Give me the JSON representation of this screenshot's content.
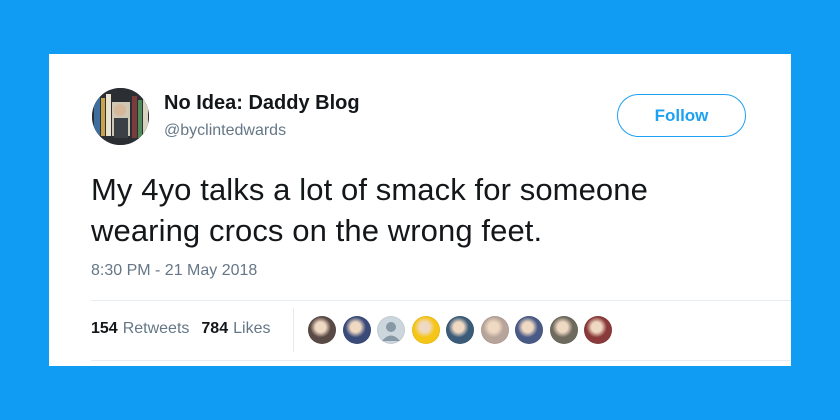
{
  "tweet": {
    "author_name": "No Idea: Daddy Blog",
    "author_handle": "@byclintedwards",
    "follow_label": "Follow",
    "text": "My 4yo talks a lot of smack for someone wearing crocs on the wrong feet.",
    "timestamp": "8:30 PM - 21 May 2018",
    "retweets_count": "154",
    "retweets_label": "Retweets",
    "likes_count": "784",
    "likes_label": "Likes"
  },
  "colors": {
    "background": "#0f9cf2",
    "accent": "#1da1f2",
    "text_primary": "#14171a",
    "text_secondary": "#657786"
  },
  "likers": [
    {
      "icon": "user-avatar-photo",
      "color": "#5a4a46"
    },
    {
      "icon": "user-avatar-photo",
      "color": "#3a4b7a"
    },
    {
      "icon": "user-avatar-default",
      "color": "#ccd6dd"
    },
    {
      "icon": "user-avatar-photo",
      "color": "#f5c518"
    },
    {
      "icon": "user-avatar-photo",
      "color": "#3b5b78"
    },
    {
      "icon": "user-avatar-photo",
      "color": "#b7a49a"
    },
    {
      "icon": "user-avatar-photo",
      "color": "#4a5a86"
    },
    {
      "icon": "user-avatar-photo",
      "color": "#6e6a5e"
    },
    {
      "icon": "user-avatar-photo",
      "color": "#8a3a3a"
    }
  ]
}
